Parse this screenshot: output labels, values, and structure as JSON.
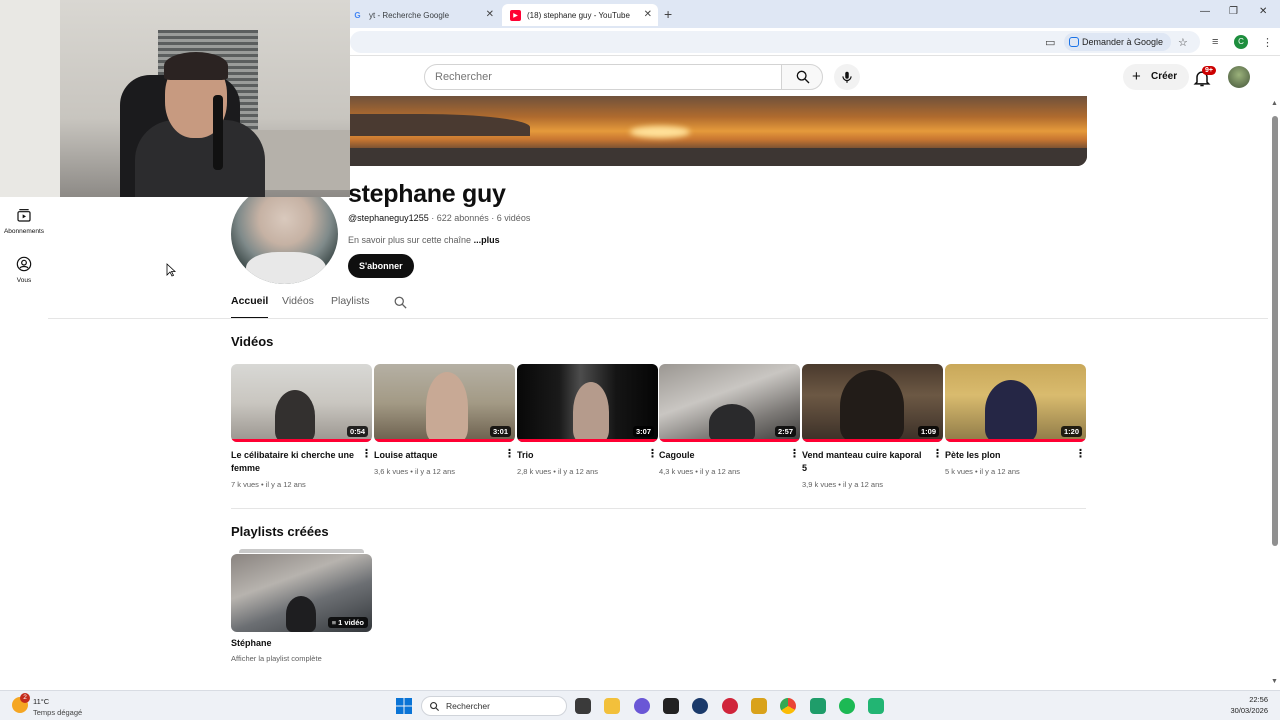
{
  "browser": {
    "tabs": [
      {
        "label": "yt - Recherche Google",
        "favicon": "google-icon"
      },
      {
        "label": "(18) stephane guy - YouTube",
        "favicon": "youtube-icon"
      }
    ],
    "ask_google": "Demander à Google",
    "profile_initial": "C"
  },
  "yt": {
    "search_placeholder": "Rechercher",
    "create_label": "Créer",
    "notif_badge": "9+"
  },
  "sidebar": {
    "items": [
      {
        "label": "Abonnements",
        "icon": "subscriptions-icon"
      },
      {
        "label": "Vous",
        "icon": "you-icon"
      }
    ]
  },
  "channel": {
    "name": "stephane guy",
    "handle": "@stephaneguy1255",
    "subscribers": "622 abonnés",
    "videos_count": "6 vidéos",
    "description": "En savoir plus sur cette chaîne",
    "more": "...plus",
    "subscribe": "S'abonner"
  },
  "tabs": [
    "Accueil",
    "Vidéos",
    "Playlists"
  ],
  "sections": {
    "videos_title": "Vidéos",
    "playlists_title": "Playlists créées"
  },
  "videos": [
    {
      "title": "Le célibataire ki cherche une femme",
      "duration": "0:54",
      "views": "7 k vues",
      "age": "il y a 12 ans"
    },
    {
      "title": "Louise attaque",
      "duration": "3:01",
      "views": "3,6 k vues",
      "age": "il y a 12 ans"
    },
    {
      "title": "Trio",
      "duration": "3:07",
      "views": "2,8 k vues",
      "age": "il y a 12 ans"
    },
    {
      "title": "Cagoule",
      "duration": "2:57",
      "views": "4,3 k vues",
      "age": "il y a 12 ans"
    },
    {
      "title": "Vend manteau cuire kaporal 5",
      "duration": "1:09",
      "views": "3,9 k vues",
      "age": "il y a 12 ans"
    },
    {
      "title": "Pète les plon",
      "duration": "1:20",
      "views": "5 k vues",
      "age": "il y a 12 ans"
    }
  ],
  "playlist": {
    "title": "Stéphane",
    "count": "1 vidéo",
    "link": "Afficher la playlist complète"
  },
  "taskbar": {
    "weather_temp": "11°C",
    "weather_desc": "Temps dégagé",
    "weather_badge": "2",
    "search_label": "Rechercher",
    "time": "22:56",
    "date": "30/03/2026"
  }
}
